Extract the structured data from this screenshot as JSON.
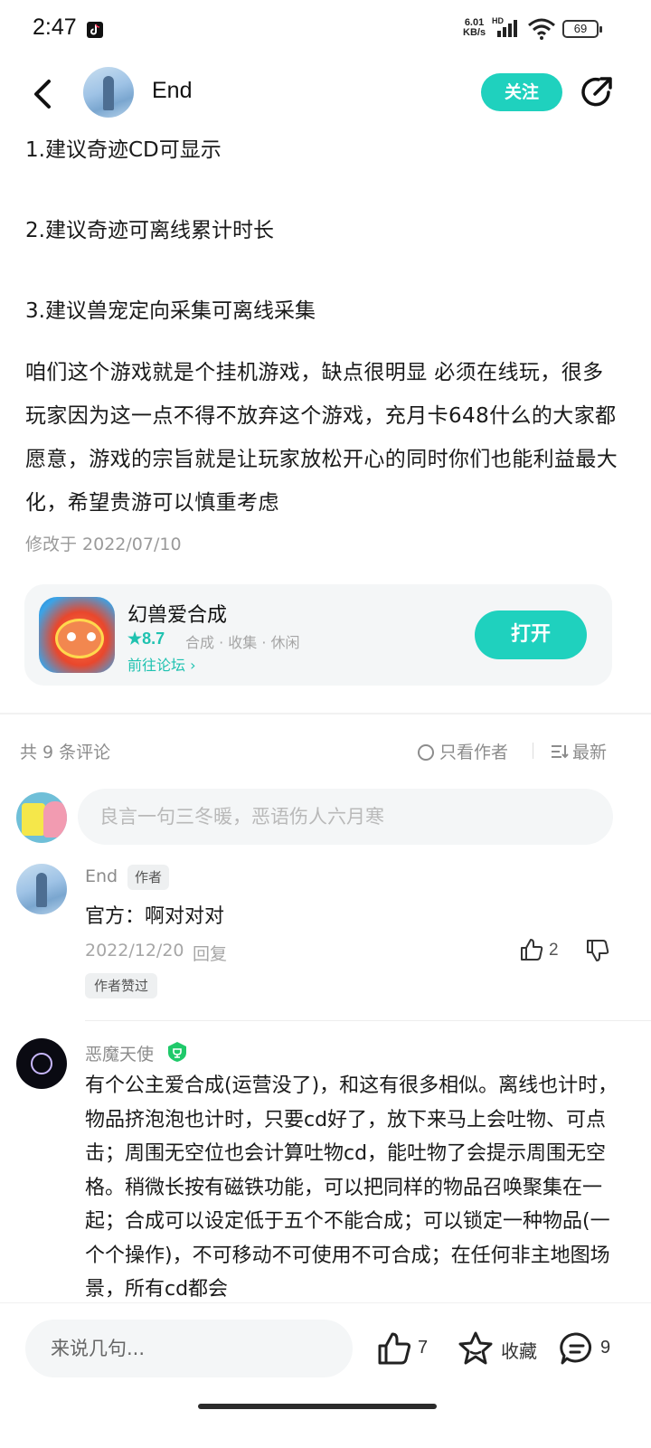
{
  "status_bar": {
    "time": "2:47",
    "net_speed_value": "6.01",
    "net_speed_unit": "KB/s",
    "network_type": "HD",
    "battery": "69"
  },
  "header": {
    "author_name": "End",
    "follow_label": "关注"
  },
  "post": {
    "lines": [
      "1.建议奇迹CD可显示",
      "2.建议奇迹可离线累计时长",
      "3.建议兽宠定向采集可离线采集"
    ],
    "paragraph": "咱们这个游戏就是个挂机游戏，缺点很明显 必须在线玩，很多玩家因为这一点不得不放弃这个游戏，充月卡648什么的大家都愿意，游戏的宗旨就是让玩家放松开心的同时你们也能利益最大化，希望贵游可以慎重考虑",
    "modified": "修改于 2022/07/10"
  },
  "game_card": {
    "name": "幻兽爱合成",
    "rating": "★8.7",
    "tags": "合成 · 收集 · 休闲",
    "forum_link": "前往论坛 ›",
    "open_label": "打开"
  },
  "comments_toolbar": {
    "count_label": "共 9 条评论",
    "author_only_label": "只看作者",
    "sort_label": "最新"
  },
  "comment_input": {
    "placeholder": "良言一句三冬暖，恶语伤人六月寒"
  },
  "comments": [
    {
      "author": "End",
      "tag": "作者",
      "text": "官方：啊对对对",
      "date": "2022/12/20",
      "reply_label": "回复",
      "likes": "2",
      "badge": "作者赞过"
    },
    {
      "author": "恶魔天使",
      "text": "有个公主爱合成(运营没了)，和这有很多相似。离线也计时，物品挤泡泡也计时，只要cd好了，放下来马上会吐物、可点击；周围无空位也会计算吐物cd，能吐物了会提示周围无空格。稍微长按有磁铁功能，可以把同样的物品召唤聚集在一起；合成可以设定低于五个不能合成；可以锁定一种物品(一个个操作)，不可移动不可使用不可合成；在任何非主地图场景，所有cd都会"
    }
  ],
  "bottom_bar": {
    "input_placeholder": "来说几句...",
    "likes": "7",
    "favorite_label": "收藏",
    "comments": "9"
  },
  "colors": {
    "accent": "#1fd1be",
    "muted_text": "#8c8c8c",
    "card_bg": "#f4f6f7"
  }
}
